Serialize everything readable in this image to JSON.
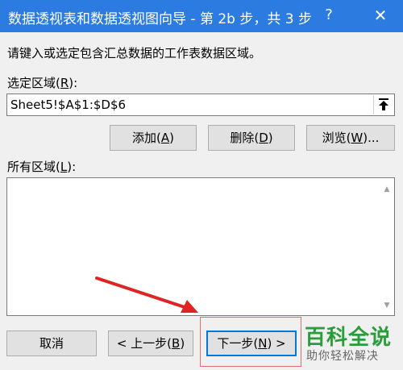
{
  "window": {
    "title": "数据透视表和数据透视图向导 - 第 2b 步，共 3 步",
    "help_glyph": "?",
    "close_glyph": "✕"
  },
  "instruction": "请键入或选定包含汇总数据的工作表数据区域。",
  "range": {
    "label_pre": "选定区域(",
    "label_key": "R",
    "label_post": "):",
    "value": "Sheet5!$A$1:$D$6"
  },
  "buttons": {
    "add": {
      "pre": "添加(",
      "key": "A",
      "post": ")"
    },
    "delete": {
      "pre": "删除(",
      "key": "D",
      "post": ")"
    },
    "browse": {
      "pre": "浏览(",
      "key": "W",
      "post": ")..."
    },
    "cancel": "取消",
    "back": {
      "pre": "< 上一步(",
      "key": "B",
      "post": ")"
    },
    "next": {
      "pre": "下一步(",
      "key": "N",
      "post": ") >"
    }
  },
  "all_ranges": {
    "label_pre": "所有区域(",
    "label_key": "L",
    "label_post": "):"
  },
  "watermark": {
    "logo": "百科全说",
    "subtitle": "助你轻松解决"
  },
  "colors": {
    "titlebar": "#2b7be0",
    "annotation": "#e02424",
    "watermark_green": "#2a9d3a"
  }
}
